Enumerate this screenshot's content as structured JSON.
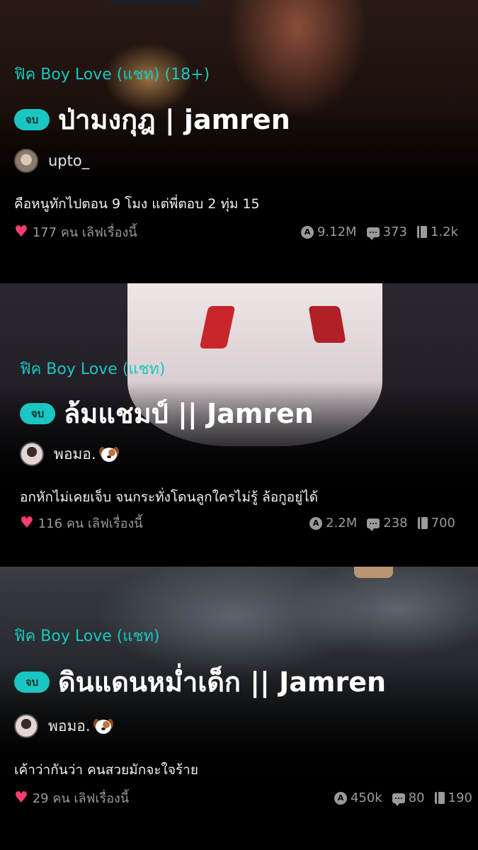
{
  "stories": [
    {
      "category": "ฟิค Boy Love (แชท) (18+)",
      "status_badge": "จบ",
      "title": "ป่ามงกุฎ | jamren",
      "author": "upto_",
      "synopsis": "คือหนูทักไปตอน 9 โมง แต่พี่ตอบ 2 ทุ่ม 15",
      "likes_text": "177 คน เลิฟเรื่องนี้",
      "views": "9.12M",
      "comments": "373",
      "chapters": "1.2k"
    },
    {
      "category": "ฟิค Boy Love (แชท)",
      "status_badge": "จบ",
      "title": "ล้มแชมป์ || Jamren",
      "author": "พอมอ.",
      "synopsis": "อกหักไม่เคยเจ็บ จนกระทั่งโดนลูกใครไม่รู้ ล้อกูอยู่ได้",
      "likes_text": "116 คน เลิฟเรื่องนี้",
      "views": "2.2M",
      "comments": "238",
      "chapters": "700"
    },
    {
      "category": "ฟิค Boy Love (แชท)",
      "status_badge": "จบ",
      "title": "ดินแดนหม่ำเด็ก || Jamren",
      "author": "พอมอ.",
      "synopsis": "เค้าว่ากันว่า คนสวยมักจะใจร้าย",
      "likes_text": "29 คน เลิฟเรื่องนี้",
      "views": "450k",
      "comments": "80",
      "chapters": "190"
    }
  ],
  "icons": {
    "likes": "heart-icon",
    "views": "views-icon",
    "comments": "comment-icon",
    "chapters": "book-icon",
    "author_emoji": "dog-emoji-icon"
  },
  "views_icon_glyph": "A",
  "colors": {
    "accent": "#19c6c2",
    "heart": "#ff3d6e",
    "meta_text": "#9a9a9a",
    "background": "#000000"
  }
}
